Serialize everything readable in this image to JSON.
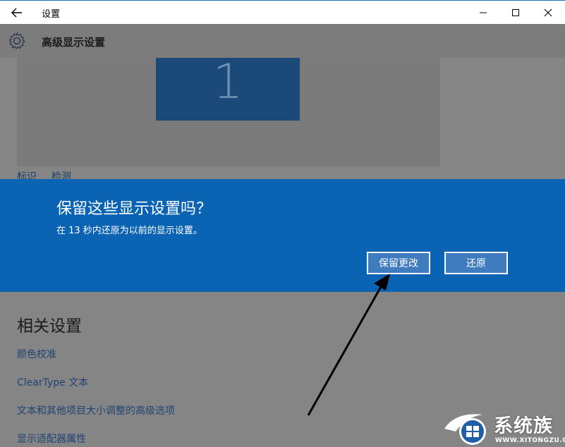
{
  "window": {
    "title": "设置",
    "back_icon": "back-arrow-icon",
    "controls": [
      "minimize-icon",
      "maximize-icon",
      "close-icon"
    ]
  },
  "page": {
    "title": "高级显示设置",
    "header_icon": "gear-icon"
  },
  "display_preview": {
    "monitor_number": "1",
    "links": [
      "标识",
      "检测"
    ]
  },
  "dialog": {
    "title": "保留这些显示设置吗？",
    "message": "在 13 秒内还原为以前的显示设置。",
    "keep_label": "保留更改",
    "revert_label": "还原",
    "background_color": "#0a63b3"
  },
  "related": {
    "heading": "相关设置",
    "links": [
      "颜色校准",
      "ClearType 文本",
      "文本和其他项目大小调整的高级选项",
      "显示适配器属性"
    ]
  },
  "watermark": {
    "brand": "系统族",
    "url": "WWW.XITONGZU.COM"
  }
}
